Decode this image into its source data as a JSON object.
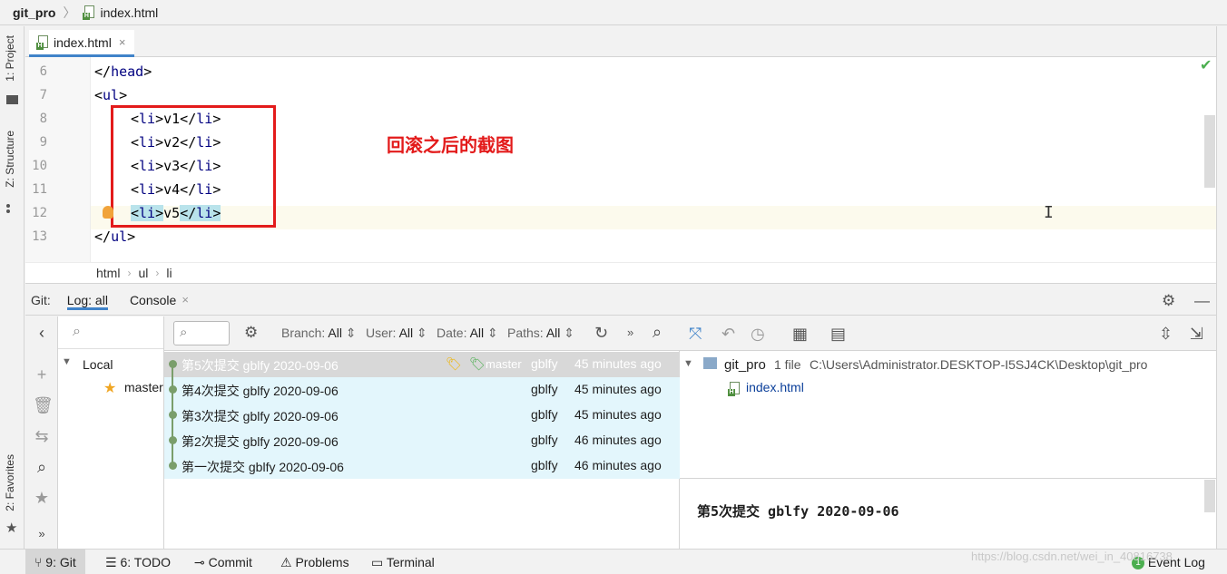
{
  "navbar": {
    "project": "git_pro",
    "file": "index.html"
  },
  "left_strip": {
    "project": "1: Project",
    "structure": "Z: Structure",
    "favorites": "2: Favorites"
  },
  "editor_tab": {
    "label": "index.html",
    "close": "×"
  },
  "editor": {
    "lines": [
      {
        "num": "6",
        "html": "</head>"
      },
      {
        "num": "7",
        "html": "<ul>"
      },
      {
        "num": "8",
        "html": "<li>v1</li>"
      },
      {
        "num": "9",
        "html": "<li>v2</li>"
      },
      {
        "num": "10",
        "html": "<li>v3</li>"
      },
      {
        "num": "11",
        "html": "<li>v4</li>"
      },
      {
        "num": "12",
        "html": "<li>v5</li>"
      },
      {
        "num": "13",
        "html": "</ul>"
      }
    ],
    "annotation": "回滚之后的截图"
  },
  "breadcrumb": [
    "html",
    "ul",
    "li"
  ],
  "git_panel": {
    "title": "Git:",
    "tabs": [
      {
        "label": "Log: all"
      },
      {
        "label": "Console",
        "close": "×"
      }
    ]
  },
  "branches": {
    "local": "Local",
    "master": "master"
  },
  "log_filters": {
    "branch": {
      "label": "Branch:",
      "value": "All"
    },
    "user": {
      "label": "User:",
      "value": "All"
    },
    "date": {
      "label": "Date:",
      "value": "All"
    },
    "paths": {
      "label": "Paths:",
      "value": "All"
    }
  },
  "commits": [
    {
      "message": "第5次提交 gblfy 2020-09-06",
      "author": "gblfy",
      "date": "45 minutes ago",
      "branch_label": "master",
      "selected": true
    },
    {
      "message": "第4次提交 gblfy 2020-09-06",
      "author": "gblfy",
      "date": "45 minutes ago"
    },
    {
      "message": "第3次提交 gblfy 2020-09-06",
      "author": "gblfy",
      "date": "45 minutes ago"
    },
    {
      "message": "第2次提交 gblfy 2020-09-06",
      "author": "gblfy",
      "date": "46 minutes ago"
    },
    {
      "message": "第一次提交 gblfy 2020-09-06",
      "author": "gblfy",
      "date": "46 minutes ago"
    }
  ],
  "details": {
    "root": "git_pro",
    "file_count": "1 file",
    "path": "C:\\Users\\Administrator.DESKTOP-I5SJ4CK\\Desktop\\git_pro",
    "file": "index.html",
    "commit_title": "第5次提交 gblfy 2020-09-06"
  },
  "statusbar": {
    "git": "9: Git",
    "todo": "6: TODO",
    "commit": "Commit",
    "problems": "Problems",
    "terminal": "Terminal",
    "event_log": "Event Log",
    "event_count": "1"
  },
  "watermark": "https://blog.csdn.net/wei_in_40816738",
  "colors": {
    "accent": "#4083c9",
    "annotation": "#e31b1b",
    "selected_row": "#d8d8d8",
    "highlight_row": "#e3f6fc"
  }
}
